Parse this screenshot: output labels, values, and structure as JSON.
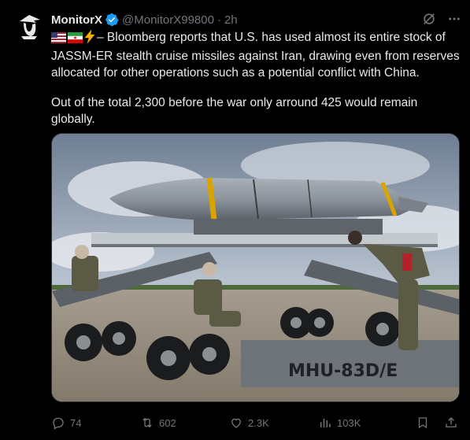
{
  "user": {
    "display_name": "MonitorX",
    "handle": "@MonitorX99800",
    "separator": "·",
    "time_ago": "2h",
    "verified": true
  },
  "tweet": {
    "flags": [
      "us-flag",
      "iran-flag",
      "lightning"
    ],
    "paragraph1": "– Bloomberg reports that U.S. has used almost its entire stock of JASSM-ER stealth cruise missiles against Iran, drawing even from reserves allocated for other operations such as a potential conflict with China.",
    "paragraph2": "Out of the total 2,300 before the war only arround 425 would remain globally."
  },
  "media": {
    "cart_marking": "MHU-83D/E"
  },
  "actions": {
    "replies": "74",
    "reposts": "602",
    "likes": "2.3K",
    "views": "103K"
  },
  "colors": {
    "background": "#000000",
    "text_primary": "#e7e9ea",
    "text_secondary": "#71767b",
    "verified_badge": "#1d9bf0",
    "border": "#2f3336"
  },
  "icons": [
    "reply-icon",
    "repost-icon",
    "like-icon",
    "views-icon",
    "bookmark-icon",
    "share-icon",
    "grok-icon",
    "more-icon",
    "verified-icon"
  ]
}
